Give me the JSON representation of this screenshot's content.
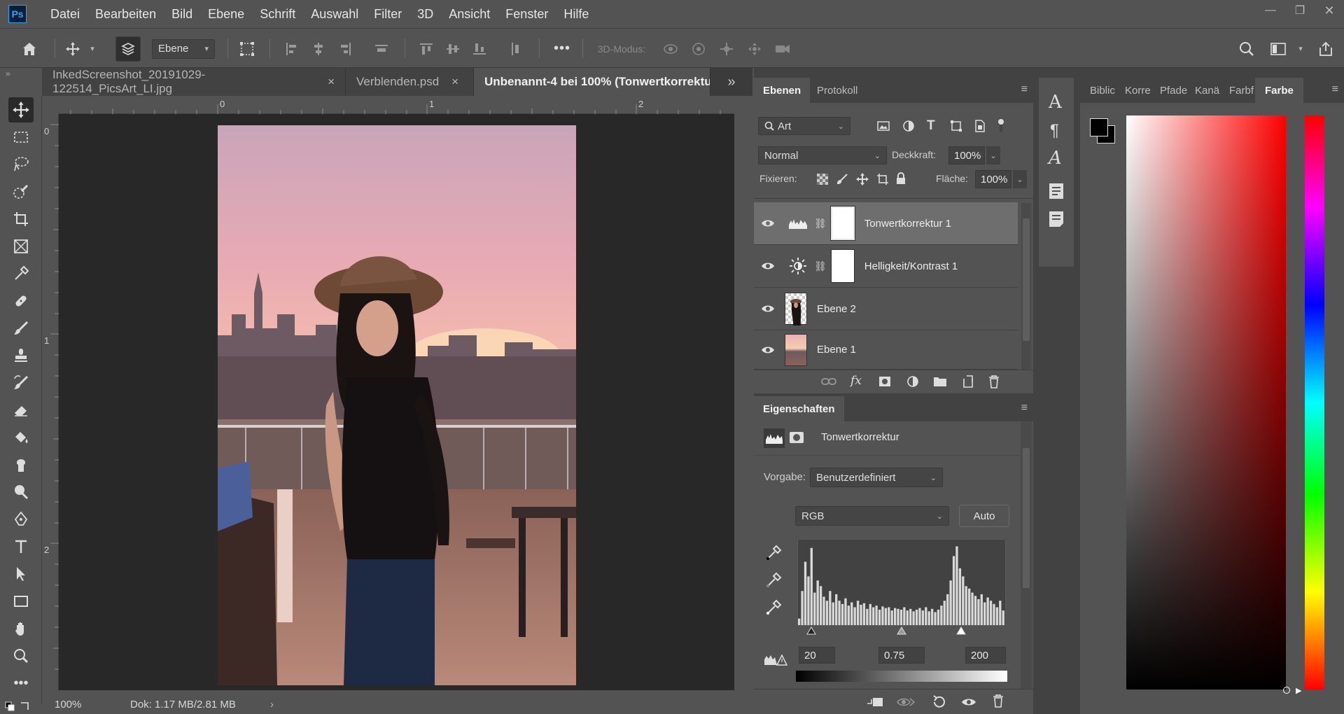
{
  "app": {
    "logo_text": "Ps"
  },
  "menu": [
    "Datei",
    "Bearbeiten",
    "Bild",
    "Ebene",
    "Schrift",
    "Auswahl",
    "Filter",
    "3D",
    "Ansicht",
    "Fenster",
    "Hilfe"
  ],
  "window_controls": {
    "minimize": "—",
    "restore": "❐",
    "close": "✕"
  },
  "options": {
    "auto_select_target": "Ebene",
    "mode_3d_label": "3D-Modus:"
  },
  "tabs": [
    {
      "label": "InkedScreenshot_20191029-122514_PicsArt_LI.jpg",
      "close": "×",
      "active": false
    },
    {
      "label": "Verblenden.psd",
      "close": "×",
      "active": false
    },
    {
      "label": "Unbenannt-4 bei 100% (Tonwertkorrektu",
      "close": "",
      "active": true
    }
  ],
  "tab_overflow": "»",
  "ruler": {
    "top_marks": [
      "0",
      "1",
      "2"
    ],
    "left_marks": [
      "0",
      "1",
      "2"
    ]
  },
  "status": {
    "zoom": "100%",
    "doc": "Dok: 1.17 MB/2.81 MB",
    "arrow": "›"
  },
  "layers_panel": {
    "tabs": [
      "Ebenen",
      "Protokoll"
    ],
    "filter_kind": "Art",
    "blend_mode": "Normal",
    "opacity_label": "Deckkraft:",
    "opacity": "100%",
    "lock_label": "Fixieren:",
    "fill_label": "Fläche:",
    "fill": "100%",
    "layers": [
      {
        "name": "Tonwertkorrektur 1",
        "type": "levels",
        "selected": true
      },
      {
        "name": "Helligkeit/Kontrast 1",
        "type": "brightness",
        "selected": false
      },
      {
        "name": "Ebene 2",
        "type": "pixel",
        "selected": false
      },
      {
        "name": "Ebene 1",
        "type": "pixel",
        "selected": false
      }
    ]
  },
  "properties_panel": {
    "tab": "Eigenschaften",
    "title": "Tonwertkorrektur",
    "preset_label": "Vorgabe:",
    "preset": "Benutzerdefiniert",
    "channel": "RGB",
    "auto_label": "Auto",
    "input_black": "20",
    "input_gamma": "0.75",
    "input_white": "200",
    "histogram": [
      8,
      42,
      78,
      60,
      95,
      40,
      55,
      48,
      35,
      30,
      42,
      28,
      38,
      30,
      26,
      33,
      24,
      28,
      22,
      30,
      25,
      27,
      20,
      26,
      22,
      24,
      19,
      23,
      21,
      22,
      18,
      21,
      20,
      19,
      22,
      18,
      20,
      17,
      19,
      21,
      18,
      22,
      17,
      20,
      16,
      19,
      24,
      30,
      38,
      55,
      85,
      97,
      70,
      60,
      48,
      45,
      40,
      36,
      32,
      38,
      28,
      34,
      30,
      26,
      22,
      30,
      18
    ]
  },
  "right_panel": {
    "tabs": [
      "Biblic",
      "Korre",
      "Pfade",
      "Kanä",
      "Farbf",
      "Farbe"
    ],
    "active_tab": "Farbe"
  },
  "colors": {
    "fg": "#000000",
    "bg": "#ffffff",
    "accent": "#2fa3f7"
  }
}
